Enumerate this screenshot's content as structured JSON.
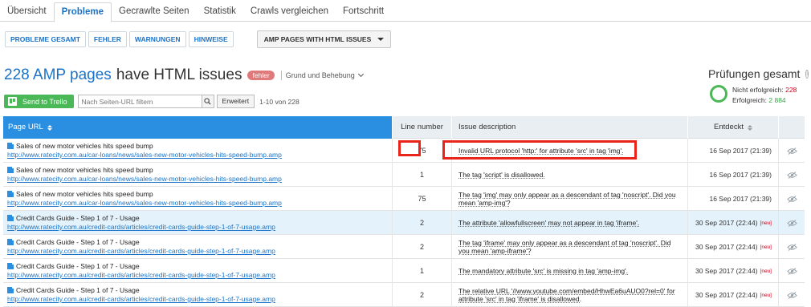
{
  "tabs": [
    "Übersicht",
    "Probleme",
    "Gecrawlte Seiten",
    "Statistik",
    "Crawls vergleichen",
    "Fortschritt"
  ],
  "active_tab": 1,
  "filters": {
    "buttons": [
      "PROBLEME GESAMT",
      "FEHLER",
      "WARNUNGEN",
      "HINWEISE"
    ],
    "dropdown": "AMP PAGES WITH HTML ISSUES"
  },
  "heading": {
    "count": "228 AMP pages",
    "rest": "have HTML issues",
    "badge": "fehler",
    "grund": "Grund und Behebung"
  },
  "summary": {
    "title": "Prüfungen gesamt",
    "fail_label": "Nicht erfolgreich:",
    "fail_value": "228",
    "ok_label": "Erfolgreich:",
    "ok_value": "2 884"
  },
  "toolbar": {
    "trello": "Send to Trello",
    "search_placeholder": "Nach Seiten-URL filtern",
    "erweitert": "Erweitert",
    "range": "1-10 von 228"
  },
  "table": {
    "headers": {
      "url": "Page URL",
      "line": "Line number",
      "issue": "Issue description",
      "date": "Entdeckt"
    },
    "rows": [
      {
        "title": "Sales of new motor vehicles hits speed bump",
        "url": "http://www.ratecity.com.au/car-loans/news/sales-new-motor-vehicles-hits-speed-bump.amp",
        "line": "75",
        "issue": "Invalid URL protocol 'http:' for attribute 'src' in tag 'img'.",
        "date": "16 Sep 2017 (21:39)",
        "new": ""
      },
      {
        "title": "Sales of new motor vehicles hits speed bump",
        "url": "http://www.ratecity.com.au/car-loans/news/sales-new-motor-vehicles-hits-speed-bump.amp",
        "line": "1",
        "issue": "The tag 'script' is disallowed.",
        "date": "16 Sep 2017 (21:39)",
        "new": ""
      },
      {
        "title": "Sales of new motor vehicles hits speed bump",
        "url": "http://www.ratecity.com.au/car-loans/news/sales-new-motor-vehicles-hits-speed-bump.amp",
        "line": "75",
        "issue": "The tag 'img' may only appear as a descendant of tag 'noscript'. Did you mean 'amp-img'?",
        "date": "16 Sep 2017 (21:39)",
        "new": ""
      },
      {
        "title": "Credit Cards Guide - Step 1 of 7 - Usage",
        "url": "http://www.ratecity.com.au/credit-cards/articles/credit-cards-guide-step-1-of-7-usage.amp",
        "line": "2",
        "issue": "The attribute 'allowfullscreen' may not appear in tag 'iframe'.",
        "date": "30 Sep 2017 (22:44)",
        "new": "[neu]"
      },
      {
        "title": "Credit Cards Guide - Step 1 of 7 - Usage",
        "url": "http://www.ratecity.com.au/credit-cards/articles/credit-cards-guide-step-1-of-7-usage.amp",
        "line": "2",
        "issue": "The tag 'iframe' may only appear as a descendant of tag 'noscript'. Did you mean 'amp-iframe'?",
        "date": "30 Sep 2017 (22:44)",
        "new": "[neu]"
      },
      {
        "title": "Credit Cards Guide - Step 1 of 7 - Usage",
        "url": "http://www.ratecity.com.au/credit-cards/articles/credit-cards-guide-step-1-of-7-usage.amp",
        "line": "1",
        "issue": "The mandatory attribute 'src' is missing in tag 'amp-img'.",
        "date": "30 Sep 2017 (22:44)",
        "new": "[neu]"
      },
      {
        "title": "Credit Cards Guide - Step 1 of 7 - Usage",
        "url": "http://www.ratecity.com.au/credit-cards/articles/credit-cards-guide-step-1-of-7-usage.amp",
        "line": "2",
        "issue": "The relative URL '//www.youtube.com/embed/HhwEa6uAUO0?rel=0' for attribute 'src' in tag 'iframe' is disallowed.",
        "date": "30 Sep 2017 (22:44)",
        "new": "[neu]"
      }
    ]
  }
}
